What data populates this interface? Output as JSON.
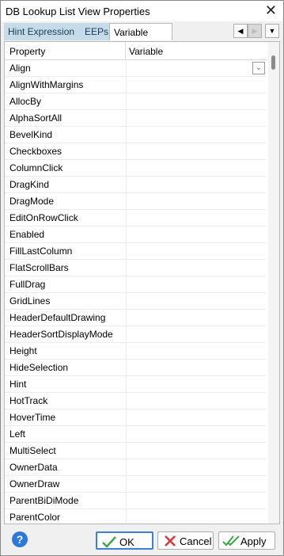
{
  "window": {
    "title": "DB Lookup List View Properties"
  },
  "tabs": [
    {
      "label": "Hint Expression"
    },
    {
      "label": "EEPs"
    },
    {
      "label": "Variable Links"
    }
  ],
  "grid": {
    "headers": {
      "property": "Property",
      "variable": "Variable"
    },
    "rows": [
      {
        "property": "Align"
      },
      {
        "property": "AlignWithMargins"
      },
      {
        "property": "AllocBy"
      },
      {
        "property": "AlphaSortAll"
      },
      {
        "property": "BevelKind"
      },
      {
        "property": "Checkboxes"
      },
      {
        "property": "ColumnClick"
      },
      {
        "property": "DragKind"
      },
      {
        "property": "DragMode"
      },
      {
        "property": "EditOnRowClick"
      },
      {
        "property": "Enabled"
      },
      {
        "property": "FillLastColumn"
      },
      {
        "property": "FlatScrollBars"
      },
      {
        "property": "FullDrag"
      },
      {
        "property": "GridLines"
      },
      {
        "property": "HeaderDefaultDrawing"
      },
      {
        "property": "HeaderSortDisplayMode"
      },
      {
        "property": "Height"
      },
      {
        "property": "HideSelection"
      },
      {
        "property": "Hint"
      },
      {
        "property": "HotTrack"
      },
      {
        "property": "HoverTime"
      },
      {
        "property": "Left"
      },
      {
        "property": "MultiSelect"
      },
      {
        "property": "OwnerData"
      },
      {
        "property": "OwnerDraw"
      },
      {
        "property": "ParentBiDiMode"
      },
      {
        "property": "ParentColor"
      }
    ]
  },
  "buttons": {
    "ok": "OK",
    "cancel": "Cancel",
    "apply": "Apply",
    "help_glyph": "?"
  },
  "icons": {
    "close": "close-icon",
    "help": "help-icon"
  },
  "colors": {
    "accent": "#2b79d8",
    "inactive_tab": "#c6dbe8",
    "cancel_x": "#e0353a",
    "check": "#3aa845"
  }
}
